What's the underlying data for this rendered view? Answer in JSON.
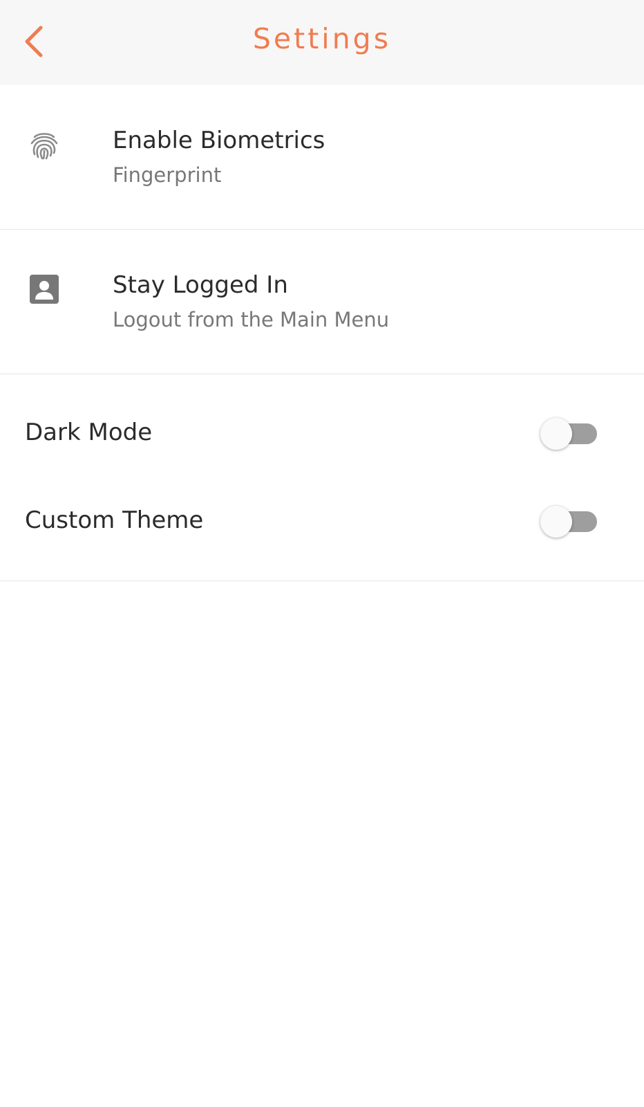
{
  "header": {
    "title": "Settings",
    "back_icon": "chevron-left-icon",
    "accent_color": "#f07c4f"
  },
  "settings": {
    "biometrics": {
      "icon": "fingerprint-icon",
      "label": "Enable Biometrics",
      "sublabel": "Fingerprint"
    },
    "stay_logged_in": {
      "icon": "account-box-icon",
      "label": "Stay Logged In",
      "sublabel": "Logout from the Main Menu"
    },
    "dark_mode": {
      "label": "Dark Mode",
      "enabled": false
    },
    "custom_theme": {
      "label": "Custom Theme",
      "enabled": false
    }
  }
}
